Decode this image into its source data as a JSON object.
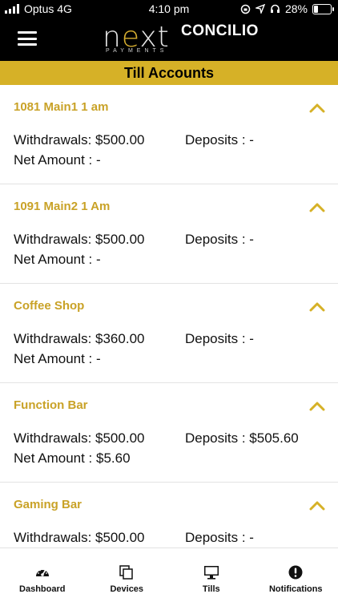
{
  "status_bar": {
    "carrier": "Optus 4G",
    "time": "4:10 pm",
    "battery": "28%",
    "battery_level": 0.28
  },
  "brand": {
    "logo_main_pre": "n",
    "logo_main_e": "e",
    "logo_main_post": "xt",
    "logo_sub": "PAYMENTS",
    "logo_brand": "CONCILIO",
    "accent_color": "#d6b127"
  },
  "page": {
    "title": "Till Accounts"
  },
  "accounts": [
    {
      "name": "1081 Main1 1 am",
      "withdrawals": "Withdrawals: $500.00",
      "deposits": "Deposits : -",
      "net": "Net Amount : -"
    },
    {
      "name": "1091 Main2 1 Am",
      "withdrawals": "Withdrawals: $500.00",
      "deposits": "Deposits : -",
      "net": "Net Amount : -"
    },
    {
      "name": "Coffee Shop",
      "withdrawals": "Withdrawals: $360.00",
      "deposits": "Deposits : -",
      "net": "Net Amount : -"
    },
    {
      "name": "Function Bar",
      "withdrawals": "Withdrawals: $500.00",
      "deposits": "Deposits : $505.60",
      "net": "Net Amount : $5.60"
    },
    {
      "name": "Gaming Bar",
      "withdrawals": "Withdrawals: $500.00",
      "deposits": "Deposits : -",
      "net": ""
    }
  ],
  "tabs": [
    {
      "label": "Dashboard",
      "icon": "speedometer-icon"
    },
    {
      "label": "Devices",
      "icon": "copy-devices-icon"
    },
    {
      "label": "Tills",
      "icon": "monitor-icon"
    },
    {
      "label": "Notifications",
      "icon": "alert-circle-icon"
    }
  ]
}
